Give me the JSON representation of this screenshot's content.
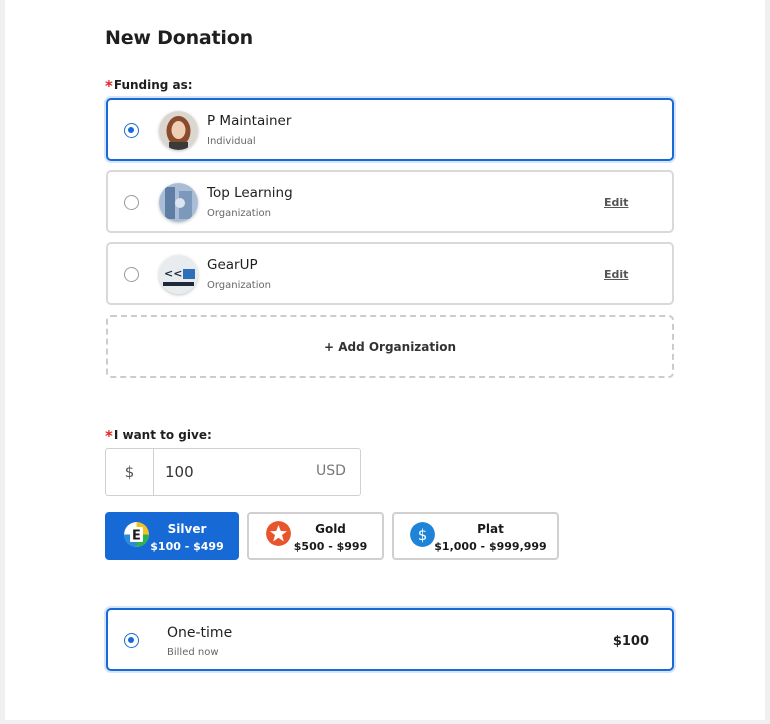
{
  "page": {
    "title": "New Donation"
  },
  "funding": {
    "label": "Funding as:",
    "options": [
      {
        "name": "P Maintainer",
        "type": "Individual",
        "selected": true,
        "edit": ""
      },
      {
        "name": "Top Learning",
        "type": "Organization",
        "selected": false,
        "edit": "Edit"
      },
      {
        "name": "GearUP",
        "type": "Organization",
        "selected": false,
        "edit": "Edit"
      }
    ],
    "add_label": "+ Add Organization"
  },
  "give": {
    "label": "I want to give:",
    "currency_symbol": "$",
    "amount": "100",
    "currency": "USD"
  },
  "tiers": [
    {
      "name": "Silver",
      "range": "$100 - $499",
      "icon": "letter-e-badge-icon",
      "active": true
    },
    {
      "name": "Gold",
      "range": "$500 - $999",
      "icon": "star-badge-icon",
      "active": false
    },
    {
      "name": "Plat",
      "range": "$1,000 - $999,999",
      "icon": "dollar-badge-icon",
      "active": false
    }
  ],
  "frequency": {
    "name": "One-time",
    "sub": "Billed now",
    "price": "$100"
  },
  "colors": {
    "accent": "#1769d6",
    "required": "#e02424",
    "gold_icon": "#e8552d",
    "plat_icon": "#1f84d8"
  }
}
